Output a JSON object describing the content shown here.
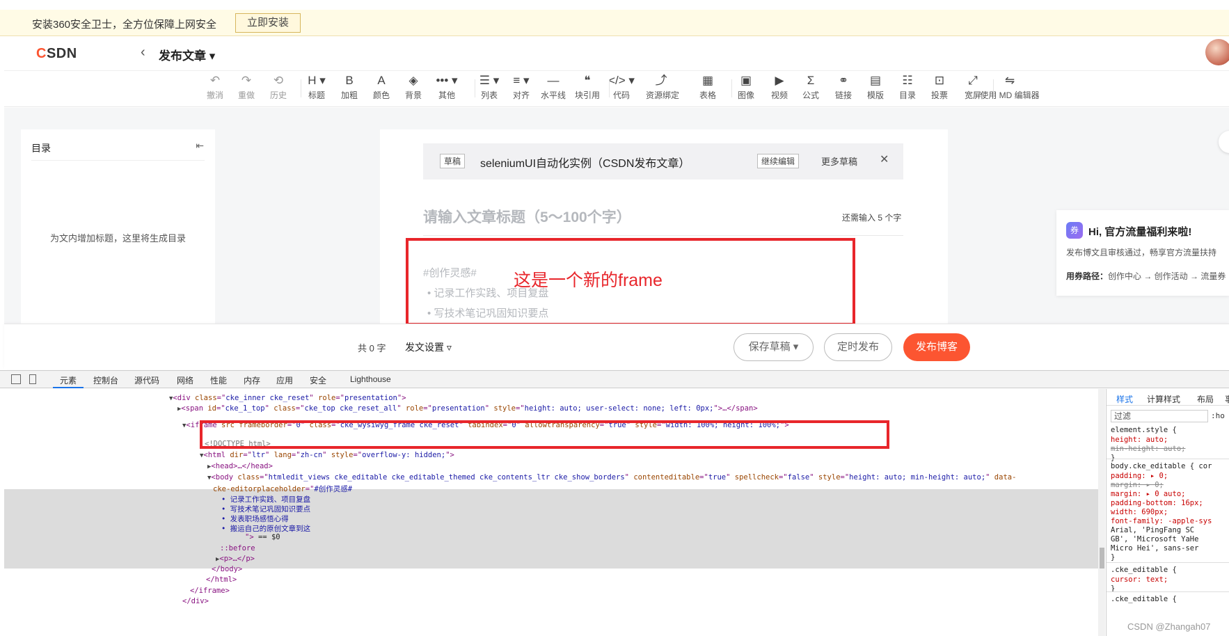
{
  "notification": {
    "text": "安装360安全卫士，全方位保障上网安全",
    "button": "立即安装"
  },
  "header": {
    "logo_c": "C",
    "logo_rest": "SDN",
    "back_icon": "chevron-left-icon",
    "title": "发布文章 ▾"
  },
  "toolbar": {
    "items": [
      {
        "icon": "↶",
        "label": "撤消"
      },
      {
        "icon": "↷",
        "label": "重做"
      },
      {
        "icon": "⟲",
        "label": "历史"
      },
      {
        "icon": "H ▾",
        "label": "标题"
      },
      {
        "icon": "B",
        "label": "加粗"
      },
      {
        "icon": "A",
        "label": "颜色"
      },
      {
        "icon": "◈",
        "label": "背景"
      },
      {
        "icon": "••• ▾",
        "label": "其他"
      },
      {
        "icon": "☰ ▾",
        "label": "列表"
      },
      {
        "icon": "≡ ▾",
        "label": "对齐"
      },
      {
        "icon": "―",
        "label": "水平线"
      },
      {
        "icon": "❝",
        "label": "块引用"
      },
      {
        "icon": "</> ▾",
        "label": "代码"
      },
      {
        "icon": "⤴",
        "label": "资源绑定"
      },
      {
        "icon": "▦",
        "label": "表格"
      },
      {
        "icon": "▣",
        "label": "图像"
      },
      {
        "icon": "▶",
        "label": "视频"
      },
      {
        "icon": "Σ",
        "label": "公式"
      },
      {
        "icon": "⚭",
        "label": "链接"
      },
      {
        "icon": "▤",
        "label": "模版"
      },
      {
        "icon": "☷",
        "label": "目录"
      },
      {
        "icon": "⊡",
        "label": "投票"
      },
      {
        "icon": "⤢",
        "label": "宽屏"
      },
      {
        "icon": "⇋",
        "label": "使用 MD 编辑器"
      }
    ]
  },
  "toc": {
    "title": "目录",
    "icon": "collapse-list-icon",
    "empty": "为文内增加标题，这里将生成目录"
  },
  "draft_bar": {
    "tag": "草稿",
    "title": "seleniumUI自动化实例（CSDN发布文章）",
    "continue": "继续编辑",
    "more": "更多草稿",
    "close": "✕"
  },
  "editor": {
    "title_placeholder": "请输入文章标题（5～100个字）",
    "title_counter": "还需输入 5 个字",
    "body_placeholder": "#创作灵感#",
    "bullets": [
      "• 记录工作实践、项目复盘",
      "• 写技术笔记巩固知识要点"
    ]
  },
  "annotation": {
    "frame_label": "这是一个新的frame",
    "color": "#e8262b"
  },
  "promo": {
    "icon": "券",
    "heading": "Hi, 官方流量福利来啦!",
    "line1": "发布博文且审核通过，畅享官方流量扶持",
    "line2_label": "用券路径：",
    "line2_text": "创作中心 → 创作活动 → 流量券"
  },
  "publish_bar": {
    "word_count": "共 0 字",
    "settings": "发文设置 ▿",
    "save_draft": "保存草稿 ▾",
    "schedule": "定时发布",
    "publish": "发布博客",
    "accent": "#fc5531"
  },
  "devtools": {
    "tabs": [
      "元素",
      "控制台",
      "源代码",
      "网络",
      "性能",
      "内存",
      "应用",
      "安全",
      "Lighthouse"
    ],
    "active_tab": "元素",
    "dom_lines": [
      {
        "indent": 243,
        "tri": "▼",
        "parts": [
          [
            "tag",
            "<div "
          ],
          [
            "an",
            "class"
          ],
          [
            "tag",
            "=\""
          ],
          [
            "av",
            "cke_inner cke_reset"
          ],
          [
            "tag",
            "\" "
          ],
          [
            "an",
            "role"
          ],
          [
            "tag",
            "=\""
          ],
          [
            "av",
            "presentation"
          ],
          [
            "tag",
            "\">"
          ]
        ]
      },
      {
        "indent": 255,
        "tri": "▶",
        "parts": [
          [
            "tag",
            "<span "
          ],
          [
            "an",
            "id"
          ],
          [
            "tag",
            "=\""
          ],
          [
            "av",
            "cke_1_top"
          ],
          [
            "tag",
            "\" "
          ],
          [
            "an",
            "class"
          ],
          [
            "tag",
            "=\""
          ],
          [
            "av",
            "cke_top cke_reset_all"
          ],
          [
            "tag",
            "\" "
          ],
          [
            "an",
            "role"
          ],
          [
            "tag",
            "=\""
          ],
          [
            "av",
            "presentation"
          ],
          [
            "tag",
            "\" "
          ],
          [
            "an",
            "style"
          ],
          [
            "tag",
            "=\""
          ],
          [
            "av",
            "height: auto; user-select: none; left: 0px;"
          ],
          [
            "tag",
            "\">…</span>"
          ]
        ]
      },
      {
        "indent": 262,
        "tri": "▼",
        "parts": [
          [
            "tag",
            "<iframe "
          ],
          [
            "an",
            "src frameborder"
          ],
          [
            "tag",
            "=\""
          ],
          [
            "av",
            "0"
          ],
          [
            "tag",
            "\" "
          ],
          [
            "an",
            "class"
          ],
          [
            "tag",
            "=\""
          ],
          [
            "av",
            "cke_wysiwyg_frame cke_reset"
          ],
          [
            "tag",
            "\" "
          ],
          [
            "an",
            "tabindex"
          ],
          [
            "tag",
            "=\""
          ],
          [
            "av",
            "0"
          ],
          [
            "tag",
            "\" "
          ],
          [
            "an",
            "allowtransparency"
          ],
          [
            "tag",
            "=\""
          ],
          [
            "av",
            "true"
          ],
          [
            "tag",
            "\" "
          ],
          [
            "an",
            "style"
          ],
          [
            "tag",
            "=\""
          ],
          [
            "av",
            "width: 100%; height: 100%;"
          ],
          [
            "tag",
            "\">"
          ]
        ]
      },
      {
        "indent": 294,
        "tri": "",
        "parts": [
          [
            "cm",
            "<!DOCTYPE html>"
          ]
        ]
      },
      {
        "indent": 287,
        "tri": "▼",
        "parts": [
          [
            "tag",
            "<html "
          ],
          [
            "an",
            "dir"
          ],
          [
            "tag",
            "=\""
          ],
          [
            "av",
            "ltr"
          ],
          [
            "tag",
            "\" "
          ],
          [
            "an",
            "lang"
          ],
          [
            "tag",
            "=\""
          ],
          [
            "av",
            "zh-cn"
          ],
          [
            "tag",
            "\" "
          ],
          [
            "an",
            "style"
          ],
          [
            "tag",
            "=\""
          ],
          [
            "av",
            "overflow-y: hidden;"
          ],
          [
            "tag",
            "\">"
          ]
        ]
      },
      {
        "indent": 298,
        "tri": "▶",
        "parts": [
          [
            "tag",
            "<head>…</head>"
          ]
        ]
      },
      {
        "indent": 298,
        "tri": "▼",
        "parts": [
          [
            "tag",
            "<body "
          ],
          [
            "an",
            "class"
          ],
          [
            "tag",
            "=\""
          ],
          [
            "av",
            "htmledit_views cke_editable cke_editable_themed cke_contents_ltr cke_show_borders"
          ],
          [
            "tag",
            "\" "
          ],
          [
            "an",
            "contenteditable"
          ],
          [
            "tag",
            "=\""
          ],
          [
            "av",
            "true"
          ],
          [
            "tag",
            "\" "
          ],
          [
            "an",
            "spellcheck"
          ],
          [
            "tag",
            "=\""
          ],
          [
            "av",
            "false"
          ],
          [
            "tag",
            "\" "
          ],
          [
            "an",
            "style"
          ],
          [
            "tag",
            "=\""
          ],
          [
            "av",
            "height: auto; min-height: auto;"
          ],
          [
            "tag",
            "\" "
          ],
          [
            "an",
            "data-"
          ]
        ]
      },
      {
        "indent": 306,
        "tri": "",
        "parts": [
          [
            "an",
            "cke-editorplaceholder"
          ],
          [
            "tag",
            "=\""
          ],
          [
            "av",
            "#创作灵感#"
          ]
        ]
      },
      {
        "indent": 318,
        "tri": "",
        "parts": [
          [
            "av",
            "• 记录工作实践、项目复盘"
          ]
        ]
      },
      {
        "indent": 318,
        "tri": "",
        "parts": [
          [
            "av",
            "• 写技术笔记巩固知识要点"
          ]
        ]
      },
      {
        "indent": 318,
        "tri": "",
        "parts": [
          [
            "av",
            "• 发表职场感悟心得"
          ]
        ]
      },
      {
        "indent": 318,
        "tri": "",
        "parts": [
          [
            "av",
            "• 搬运自己的原创文章到这"
          ]
        ]
      },
      {
        "indent": 352,
        "tri": "",
        "parts": [
          [
            "tag",
            "\">"
          ],
          [
            "tx",
            " == $0"
          ]
        ]
      },
      {
        "indent": 316,
        "tri": "",
        "parts": [
          [
            "tag",
            "::before"
          ]
        ]
      },
      {
        "indent": 310,
        "tri": "▶",
        "parts": [
          [
            "tag",
            "<p>…</p>"
          ]
        ]
      },
      {
        "indent": 304,
        "tri": "",
        "parts": [
          [
            "tag",
            "</body>"
          ]
        ]
      },
      {
        "indent": 296,
        "tri": "",
        "parts": [
          [
            "tag",
            "</html>"
          ]
        ]
      },
      {
        "indent": 273,
        "tri": "",
        "parts": [
          [
            "tag",
            "</iframe>"
          ]
        ]
      },
      {
        "indent": 262,
        "tri": "",
        "parts": [
          [
            "tag",
            "</div>"
          ]
        ]
      }
    ],
    "styles_tabs": [
      "样式",
      "计算样式",
      "布局",
      "事"
    ],
    "filter_placeholder": "过滤",
    "hov": ":ho",
    "style_lines": [
      {
        "t": "element.style {",
        "k": "sel"
      },
      {
        "t": "  height: auto;",
        "k": "prop"
      },
      {
        "t": "  min-height: auto;",
        "k": "strike"
      },
      {
        "t": "}",
        "k": "sel"
      },
      {
        "t": "body.cke_editable {  cor",
        "k": "sel"
      },
      {
        "t": "  padding: ▸ 0;",
        "k": "prop"
      },
      {
        "t": "  margin: ▸ 0;",
        "k": "strike"
      },
      {
        "t": "  margin: ▸ 0 auto;",
        "k": "prop"
      },
      {
        "t": "  padding-bottom: 16px;",
        "k": "prop"
      },
      {
        "t": "  width: 690px;",
        "k": "prop"
      },
      {
        "t": "  font-family: -apple-sys",
        "k": "prop"
      },
      {
        "t": "    Arial, 'PingFang SC",
        "k": "plain"
      },
      {
        "t": "    GB', 'Microsoft YaHe",
        "k": "plain"
      },
      {
        "t": "    Micro Hei', sans-ser",
        "k": "plain"
      },
      {
        "t": "}",
        "k": "sel"
      },
      {
        "t": ".cke_editable {",
        "k": "sel"
      },
      {
        "t": "  cursor: text;",
        "k": "prop"
      },
      {
        "t": "}",
        "k": "sel"
      },
      {
        "t": ".cke_editable {",
        "k": "sel"
      }
    ],
    "watermark": "CSDN @Zhangah07"
  }
}
